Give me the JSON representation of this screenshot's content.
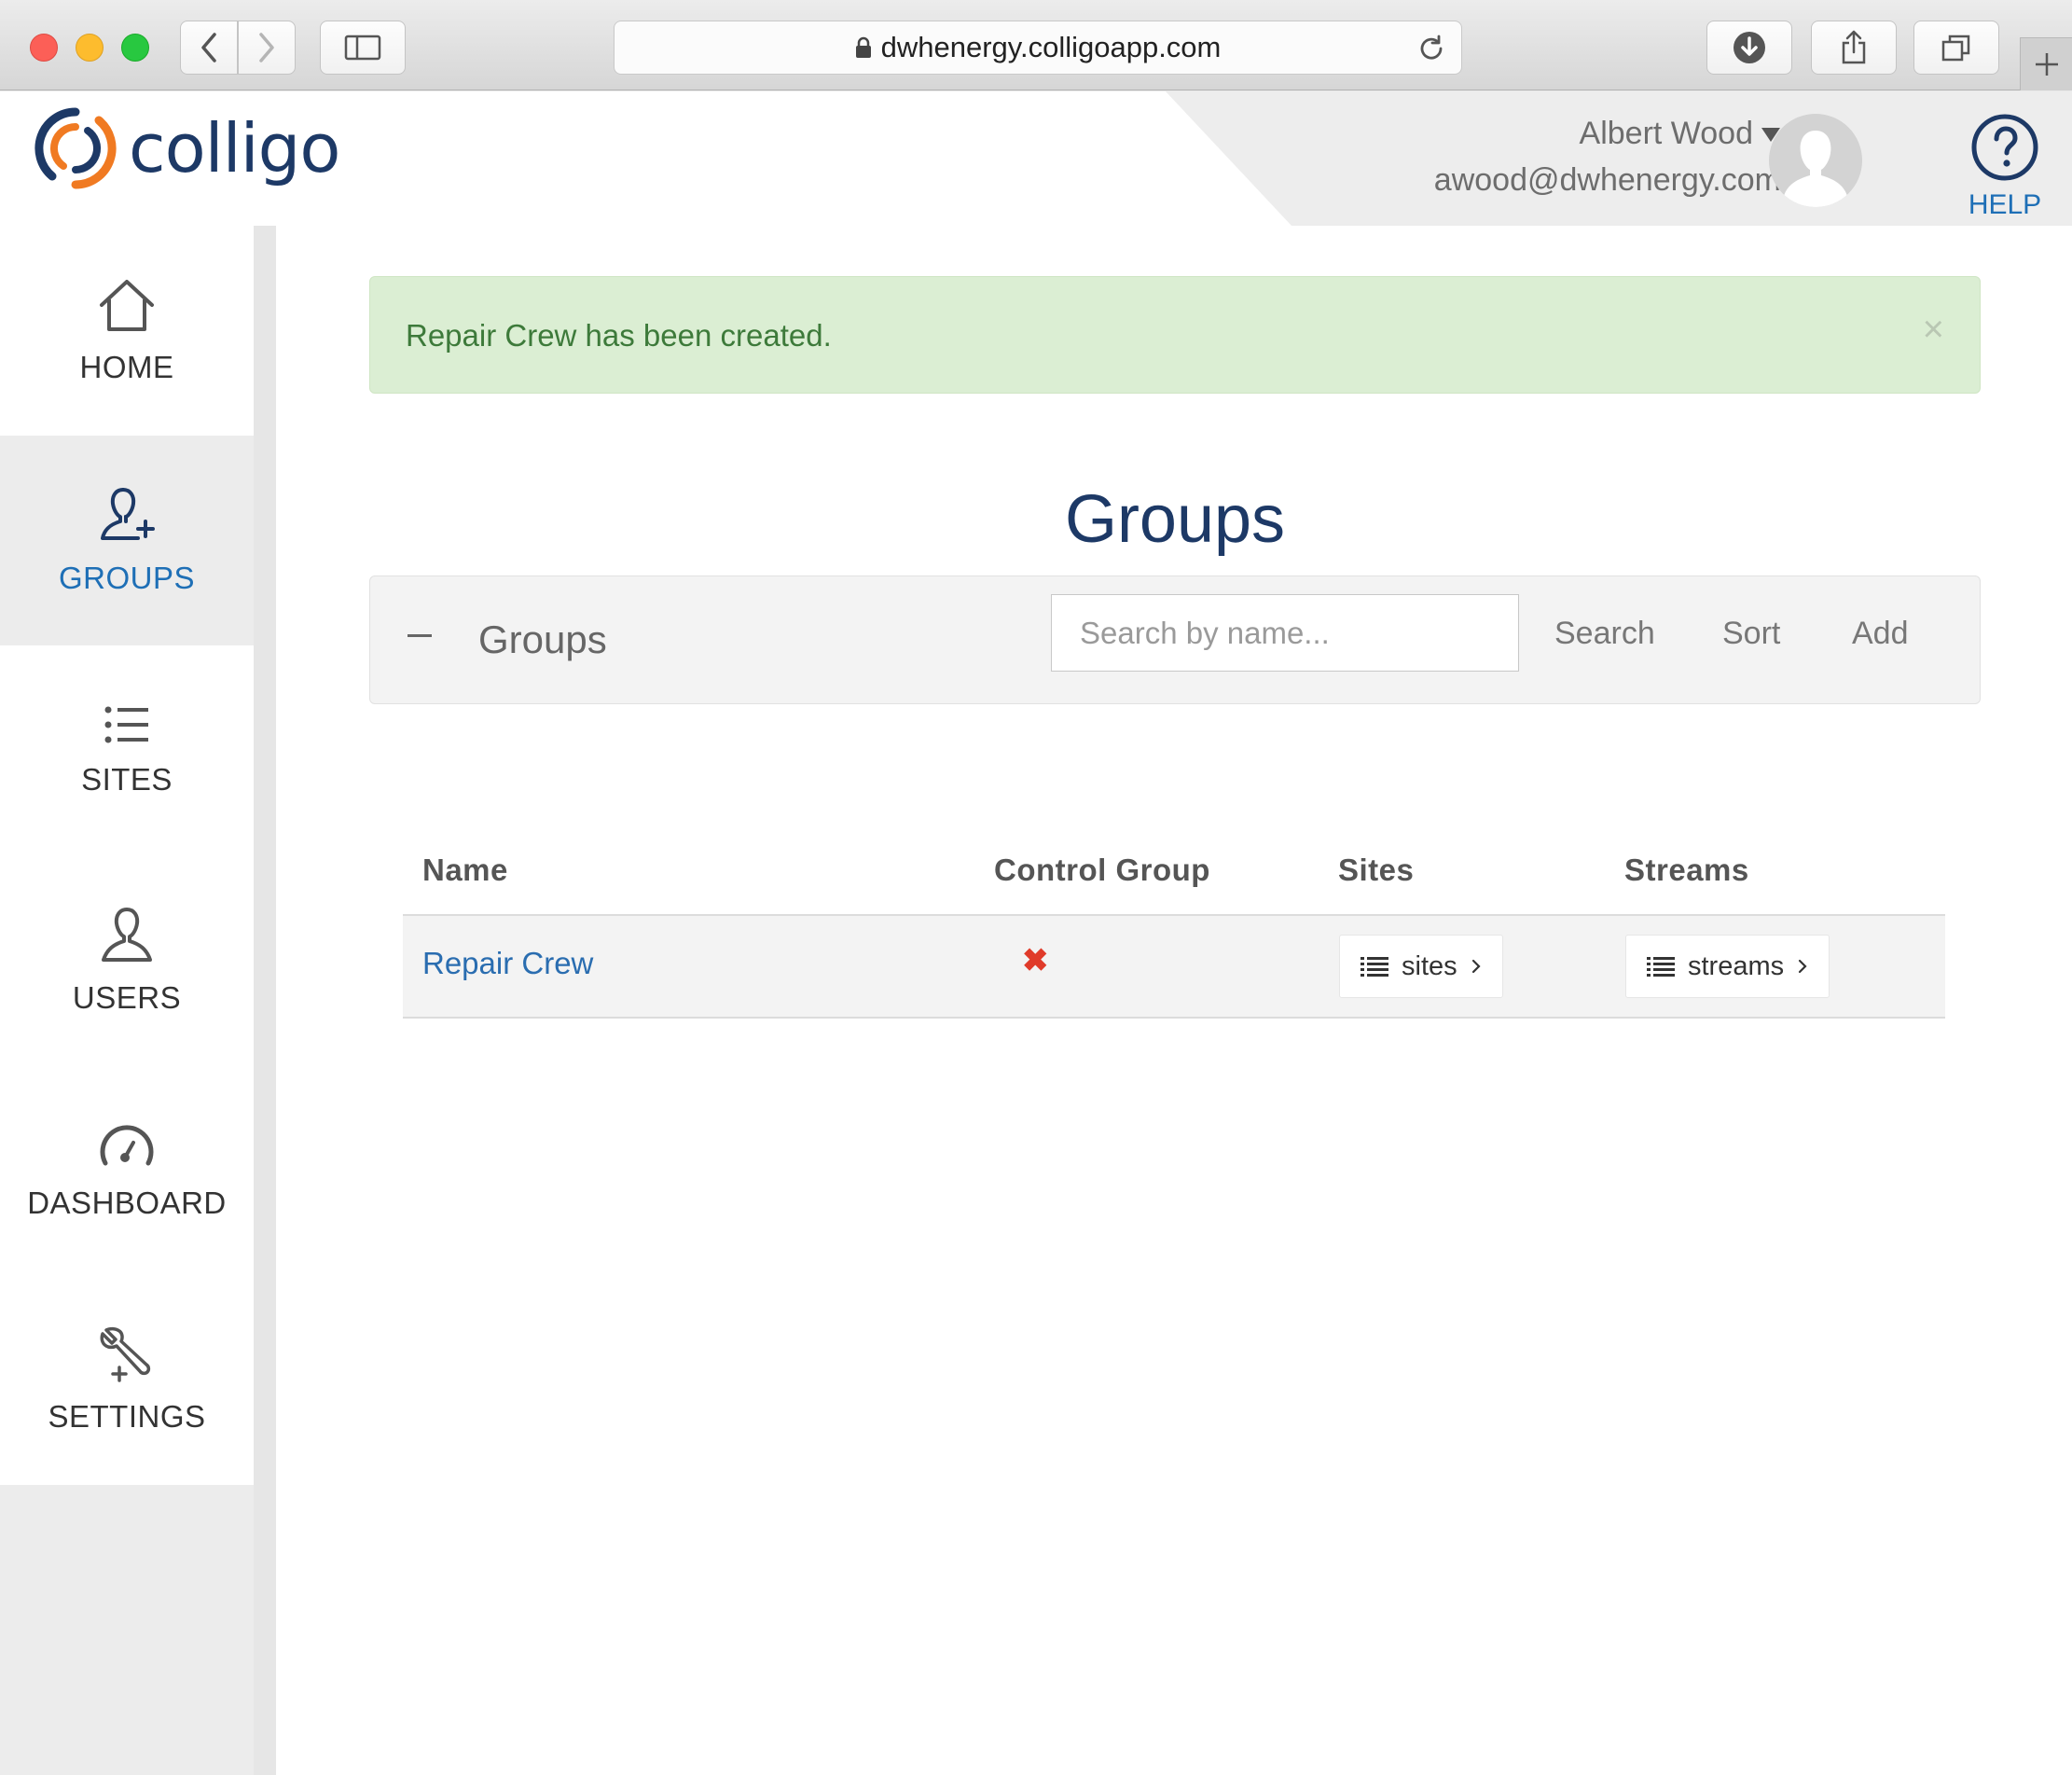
{
  "browser": {
    "url": "dwhenergy.colligoapp.com"
  },
  "app": {
    "logo_text": "colligo",
    "brand_color": "#1d3966",
    "accent_color": "#f07a22"
  },
  "user": {
    "name": "Albert Wood",
    "email": "awood@dwhenergy.com",
    "dropdown_icon": "caret-down-icon"
  },
  "help": {
    "label": "HELP",
    "icon": "question-circle-icon"
  },
  "sidebar": {
    "items": [
      {
        "label": "HOME",
        "icon": "home-icon",
        "active": false
      },
      {
        "label": "GROUPS",
        "icon": "user-plus-icon",
        "active": true
      },
      {
        "label": "SITES",
        "icon": "list-icon",
        "active": false
      },
      {
        "label": "USERS",
        "icon": "user-icon",
        "active": false
      },
      {
        "label": "DASHBOARD",
        "icon": "gauge-icon",
        "active": false
      },
      {
        "label": "SETTINGS",
        "icon": "wrench-icon",
        "active": false
      }
    ]
  },
  "alert": {
    "message": "Repair Crew has been created.",
    "close": "×",
    "color": "#dbeed3"
  },
  "page": {
    "title": "Groups"
  },
  "panel": {
    "title": "Groups",
    "search_placeholder": "Search by name...",
    "search_label": "Search",
    "sort_label": "Sort",
    "add_label": "Add"
  },
  "table": {
    "headers": [
      "Name",
      "Control Group",
      "Sites",
      "Streams"
    ],
    "rows": [
      {
        "name": "Repair Crew",
        "control_group": "✖",
        "sites_button": "sites",
        "streams_button": "streams"
      }
    ]
  }
}
